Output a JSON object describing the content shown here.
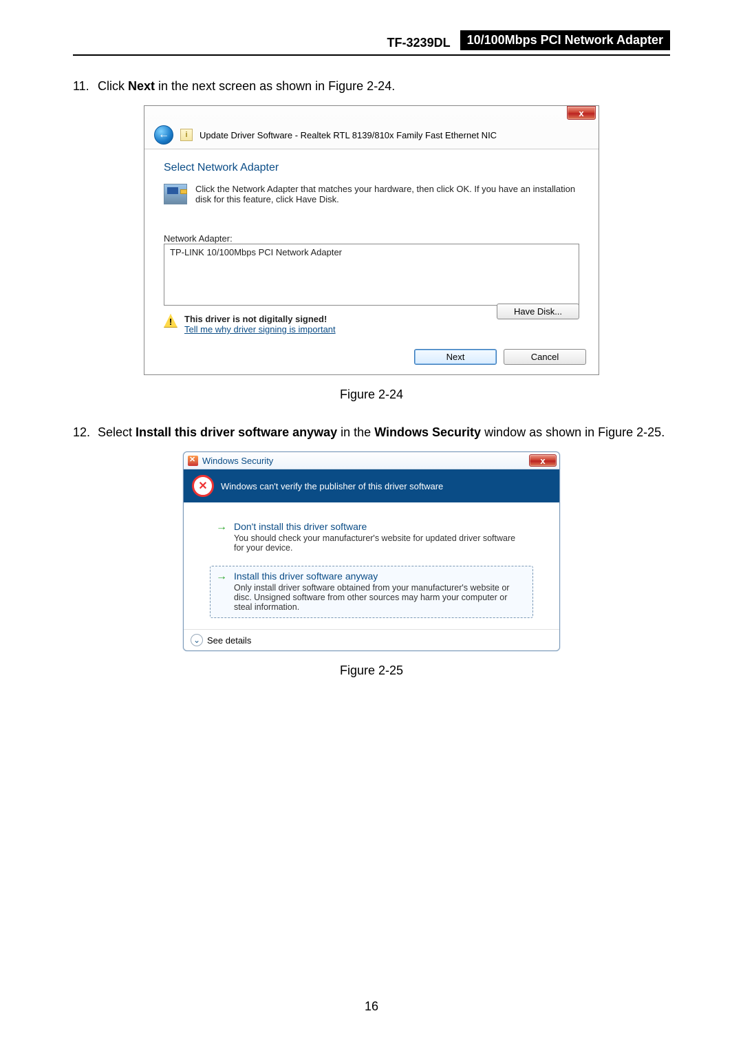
{
  "header": {
    "model": "TF-3239DL",
    "product": "10/100Mbps PCI Network Adapter"
  },
  "step11": {
    "num": "11.",
    "pre": "Click ",
    "bold": "Next",
    "post": " in the next screen as shown in Figure 2-24."
  },
  "fig1_caption": "Figure 2-24",
  "step12": {
    "num": "12.",
    "pre": "Select ",
    "bold1": "Install this driver software anyway",
    "mid": " in the ",
    "bold2": "Windows Security",
    "post": " window as shown in Figure 2-25."
  },
  "fig2_caption": "Figure 2-25",
  "page_number": "16",
  "dlg1": {
    "close_glyph": "x",
    "back_glyph": "←",
    "mini_glyph": "i",
    "title": "Update Driver Software -  Realtek RTL 8139/810x Family Fast Ethernet NIC",
    "heading": "Select Network Adapter",
    "instruction": "Click the Network Adapter that matches your hardware, then click OK. If you have an installation disk for this feature, click Have Disk.",
    "list_label": "Network Adapter:",
    "list_item": "TP-LINK 10/100Mbps PCI Network Adapter",
    "warn_glyph": "!",
    "not_signed": "This driver is not digitally signed!",
    "tell_me": "Tell me why driver signing is important",
    "have_disk": "Have Disk...",
    "next": "Next",
    "cancel": "Cancel"
  },
  "dlg2": {
    "title": "Windows Security",
    "close_glyph": "x",
    "alert_glyph": "✕",
    "alert_text": "Windows can't verify the publisher of this driver software",
    "opt1_title": "Don't install this driver software",
    "opt1_sub": "You should check your manufacturer's website for updated driver software for your device.",
    "opt2_title": "Install this driver software anyway",
    "opt2_sub": "Only install driver software obtained from your manufacturer's website or disc. Unsigned software from other sources may harm your computer or steal information.",
    "arrow_glyph": "→",
    "chev_glyph": "⌄",
    "see_details": "See details"
  }
}
